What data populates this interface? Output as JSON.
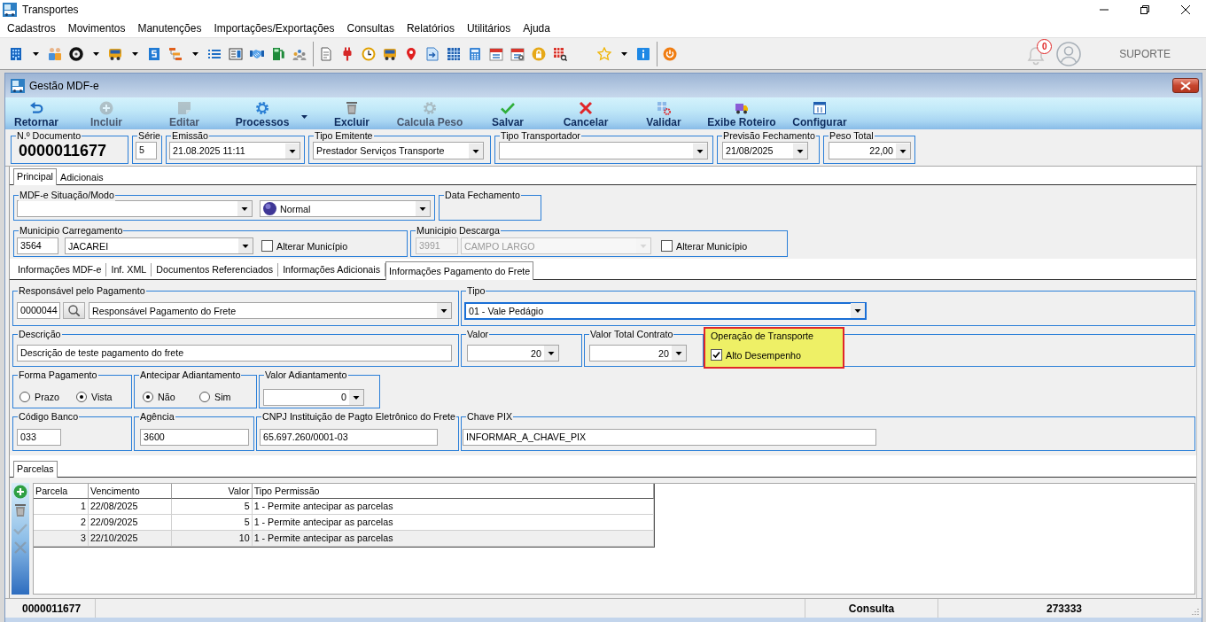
{
  "window": {
    "title": "Transportes"
  },
  "menu": [
    "Cadastros",
    "Movimentos",
    "Manutenções",
    "Importações/Exportações",
    "Consultas",
    "Relatórios",
    "Utilitários",
    "Ajuda"
  ],
  "notifications": {
    "count": "0"
  },
  "user": {
    "name": "SUPORTE"
  },
  "document_window": {
    "title": "Gestão MDF-e",
    "toolbar": [
      {
        "label": "Retornar",
        "disabled": false,
        "dropdown": false
      },
      {
        "label": "Incluir",
        "disabled": true,
        "dropdown": false
      },
      {
        "label": "Editar",
        "disabled": true,
        "dropdown": false
      },
      {
        "label": "Processos",
        "disabled": false,
        "dropdown": true
      },
      {
        "label": "Excluir",
        "disabled": false,
        "dropdown": false
      },
      {
        "label": "Calcula Peso",
        "disabled": true,
        "dropdown": false
      },
      {
        "label": "Salvar",
        "disabled": false,
        "dropdown": false
      },
      {
        "label": "Cancelar",
        "disabled": false,
        "dropdown": false
      },
      {
        "label": "Validar",
        "disabled": false,
        "dropdown": false
      },
      {
        "label": "Exibe Roteiro",
        "disabled": false,
        "dropdown": false
      },
      {
        "label": "Configurar",
        "disabled": false,
        "dropdown": false
      }
    ],
    "header_fields": [
      {
        "kind": "document_number",
        "label": "N.º Documento",
        "value": "0000011677"
      },
      {
        "kind": "text",
        "label": "Série",
        "value": "5"
      },
      {
        "kind": "combo",
        "label": "Emissão",
        "value": "21.08.2025 11:11"
      },
      {
        "kind": "combo",
        "label": "Tipo Emitente",
        "value": "Prestador Serviços Transporte"
      },
      {
        "kind": "combo",
        "label": "Tipo Transportador"
      },
      {
        "kind": "combo",
        "label": "Previsão Fechamento",
        "value": "21/08/2025"
      },
      {
        "kind": "numeric_combo",
        "label": "Peso Total",
        "value": "22,00"
      }
    ],
    "tabs": [
      {
        "label": "Principal",
        "selected": true
      },
      {
        "label": "Adicionais",
        "selected": false
      }
    ],
    "principal": {
      "situacao_modo": {
        "label": "MDF-e Situação/Modo",
        "mode": "Normal"
      },
      "data_fechamento": {
        "label": "Data Fechamento"
      },
      "municipios": [
        {
          "label": "Municipio Carregamento",
          "code": "3564",
          "name": "JACAREI",
          "disabled": false,
          "checkbox": {
            "label": "Alterar Município",
            "checked": false
          }
        },
        {
          "label": "Municipio Descarga",
          "code": "3991",
          "name": "CAMPO LARGO",
          "disabled": true,
          "checkbox": {
            "label": "Alterar Município",
            "checked": false
          }
        }
      ]
    },
    "detail_tabs": [
      {
        "label": "Informações MDF-e",
        "selected": false
      },
      {
        "label": "Inf. XML",
        "selected": false
      },
      {
        "label": "Documentos Referenciados",
        "selected": false
      },
      {
        "label": "Informações Adicionais",
        "selected": false
      },
      {
        "label": "Informações Pagamento do Frete",
        "selected": true
      }
    ],
    "payment": {
      "responsavel": {
        "label": "Responsável pelo Pagamento",
        "code": "0000044",
        "name": "Responsável Pagamento do Frete"
      },
      "tipo": {
        "label": "Tipo",
        "value": "01 - Vale Pedágio",
        "focused": true
      },
      "descricao": {
        "label": "Descrição",
        "value": "Descrição de teste pagamento do frete"
      },
      "valor": {
        "label": "Valor",
        "value": "20"
      },
      "valor_total_contrato": {
        "label": "Valor Total Contrato",
        "value": "20"
      },
      "operacao_transporte": {
        "label": "Operação de Transporte",
        "highlighted": true,
        "checkbox": {
          "label": "Alto Desempenho",
          "checked": true
        }
      },
      "forma_pagamento": {
        "label": "Forma Pagamento",
        "options": [
          {
            "label": "Prazo",
            "selected": false
          },
          {
            "label": "Vista",
            "selected": true
          }
        ]
      },
      "antecipar_adiantamento": {
        "label": "Antecipar Adiantamento",
        "options": [
          {
            "label": "Não",
            "selected": true
          },
          {
            "label": "Sim",
            "selected": false
          }
        ]
      },
      "valor_adiantamento": {
        "label": "Valor Adiantamento",
        "value": "0"
      },
      "codigo_banco": {
        "label": "Código Banco",
        "value": "033"
      },
      "agencia": {
        "label": "Agência",
        "value": "3600"
      },
      "cnpj": {
        "label": "CNPJ Instituição de Pagto Eletrônico do Frete",
        "value": "65.697.260/0001-03"
      },
      "chave_pix": {
        "label": "Chave PIX",
        "value": "INFORMAR_A_CHAVE_PIX"
      }
    },
    "parcelas": {
      "tabs": [
        {
          "label": "Parcelas",
          "selected": true
        }
      ],
      "tools": [
        {
          "disabled": false
        },
        {
          "disabled": false
        },
        {
          "disabled": true
        },
        {
          "disabled": true
        }
      ],
      "columns": [
        "Parcela",
        "Vencimento",
        "Valor",
        "Tipo Permissão"
      ],
      "rows": [
        {
          "cells": [
            "1",
            "22/08/2025",
            "5",
            "1 - Permite antecipar as parcelas"
          ],
          "selected": false
        },
        {
          "cells": [
            "2",
            "22/09/2025",
            "5",
            "1 - Permite antecipar as parcelas"
          ],
          "selected": false
        },
        {
          "cells": [
            "3",
            "22/10/2025",
            "10",
            "1 - Permite antecipar as parcelas"
          ],
          "selected": true
        }
      ]
    },
    "status_bar": {
      "document_number": "0000011677",
      "mode": "Consulta",
      "code": "273333"
    }
  }
}
